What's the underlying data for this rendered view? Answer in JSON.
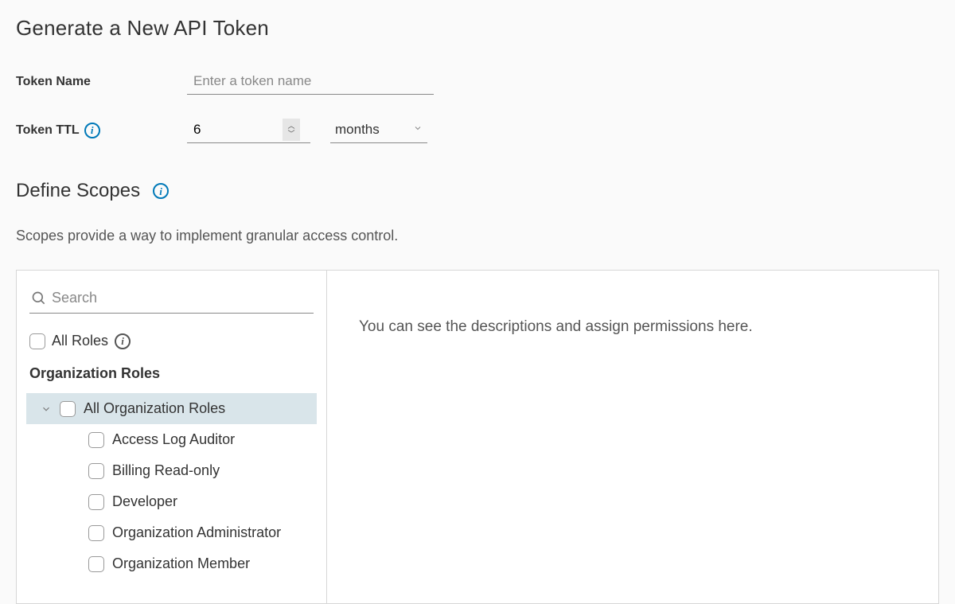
{
  "page": {
    "title": "Generate a New API Token"
  },
  "form": {
    "tokenName": {
      "label": "Token Name",
      "value": "",
      "placeholder": "Enter a token name"
    },
    "tokenTTL": {
      "label": "Token TTL",
      "value": "6",
      "unit": "months"
    }
  },
  "scopes": {
    "title": "Define Scopes",
    "description": "Scopes provide a way to implement granular access control.",
    "searchPlaceholder": "Search",
    "allRolesLabel": "All Roles",
    "orgRolesHeader": "Organization Roles",
    "allOrgRolesLabel": "All Organization Roles",
    "roles": [
      "Access Log Auditor",
      "Billing Read-only",
      "Developer",
      "Organization Administrator",
      "Organization Member"
    ],
    "rightPanelText": "You can see the descriptions and assign permissions here."
  }
}
